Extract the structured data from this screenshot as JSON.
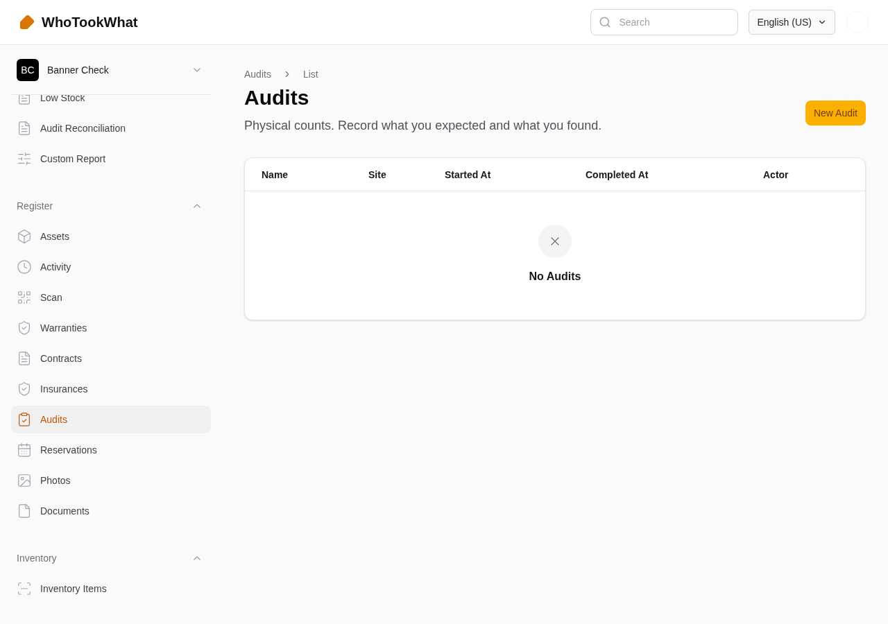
{
  "brand": {
    "name": "WhoTookWhat"
  },
  "header": {
    "search": {
      "placeholder": "Search"
    },
    "language": "English (US)"
  },
  "sidebar": {
    "team": {
      "initials": "BC",
      "name": "Banner Check"
    },
    "top_items": [
      {
        "label": "Low Stock",
        "selected": false
      },
      {
        "label": "Audit Reconciliation",
        "selected": false
      },
      {
        "label": "Custom Report",
        "selected": false
      }
    ],
    "sections": [
      {
        "title": "Register",
        "expanded": true,
        "items": [
          {
            "label": "Assets",
            "selected": false
          },
          {
            "label": "Activity",
            "selected": false
          },
          {
            "label": "Scan",
            "selected": false
          },
          {
            "label": "Warranties",
            "selected": false
          },
          {
            "label": "Contracts",
            "selected": false
          },
          {
            "label": "Insurances",
            "selected": false
          },
          {
            "label": "Audits",
            "selected": true
          },
          {
            "label": "Reservations",
            "selected": false
          },
          {
            "label": "Photos",
            "selected": false
          },
          {
            "label": "Documents",
            "selected": false
          }
        ]
      },
      {
        "title": "Inventory",
        "expanded": true,
        "items": [
          {
            "label": "Inventory Items",
            "selected": false
          }
        ]
      }
    ]
  },
  "breadcrumb": [
    "Audits",
    "List"
  ],
  "page": {
    "title": "Audits",
    "subtitle": "Physical counts. Record what you expected and what you found.",
    "action": "New Audit"
  },
  "table": {
    "columns": [
      "Name",
      "Site",
      "Started At",
      "Completed At",
      "Actor"
    ],
    "empty_message": "No Audits"
  }
}
